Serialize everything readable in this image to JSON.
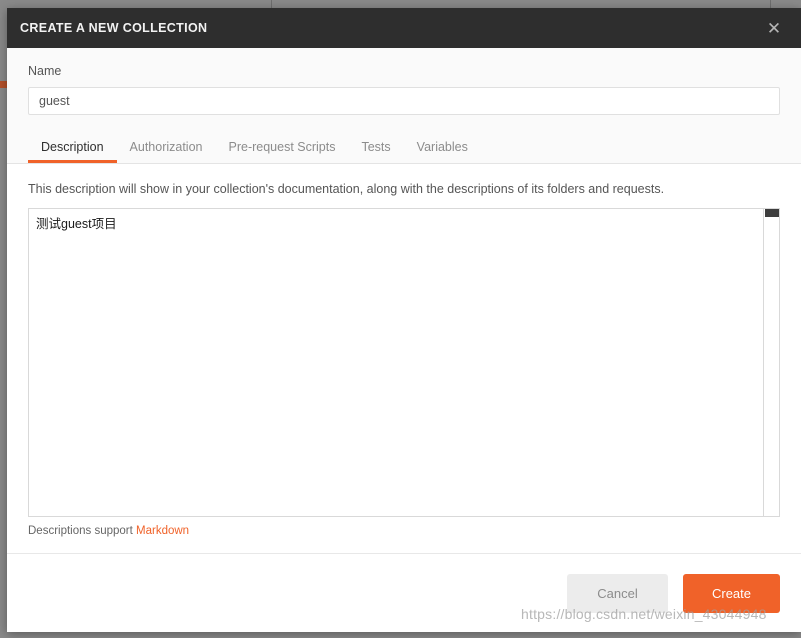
{
  "modal": {
    "title": "CREATE A NEW COLLECTION",
    "close_icon": "close-icon"
  },
  "form": {
    "name_label": "Name",
    "name_value": "guest",
    "name_placeholder": ""
  },
  "tabs": [
    {
      "label": "Description",
      "active": true
    },
    {
      "label": "Authorization",
      "active": false
    },
    {
      "label": "Pre-request Scripts",
      "active": false
    },
    {
      "label": "Tests",
      "active": false
    },
    {
      "label": "Variables",
      "active": false
    }
  ],
  "description": {
    "helper_text": "This description will show in your collection's documentation, along with the descriptions of its folders and requests.",
    "textarea_value": "测试guest项目",
    "textarea_placeholder": "",
    "markdown_note_prefix": "Descriptions support ",
    "markdown_link_label": "Markdown"
  },
  "footer": {
    "cancel_label": "Cancel",
    "create_label": "Create"
  },
  "watermark": {
    "text": "https://blog.csdn.net/weixin_43044948"
  },
  "colors": {
    "accent": "#f06229",
    "header_bg": "#2e2e2e",
    "backdrop": "#8a8a8a"
  }
}
